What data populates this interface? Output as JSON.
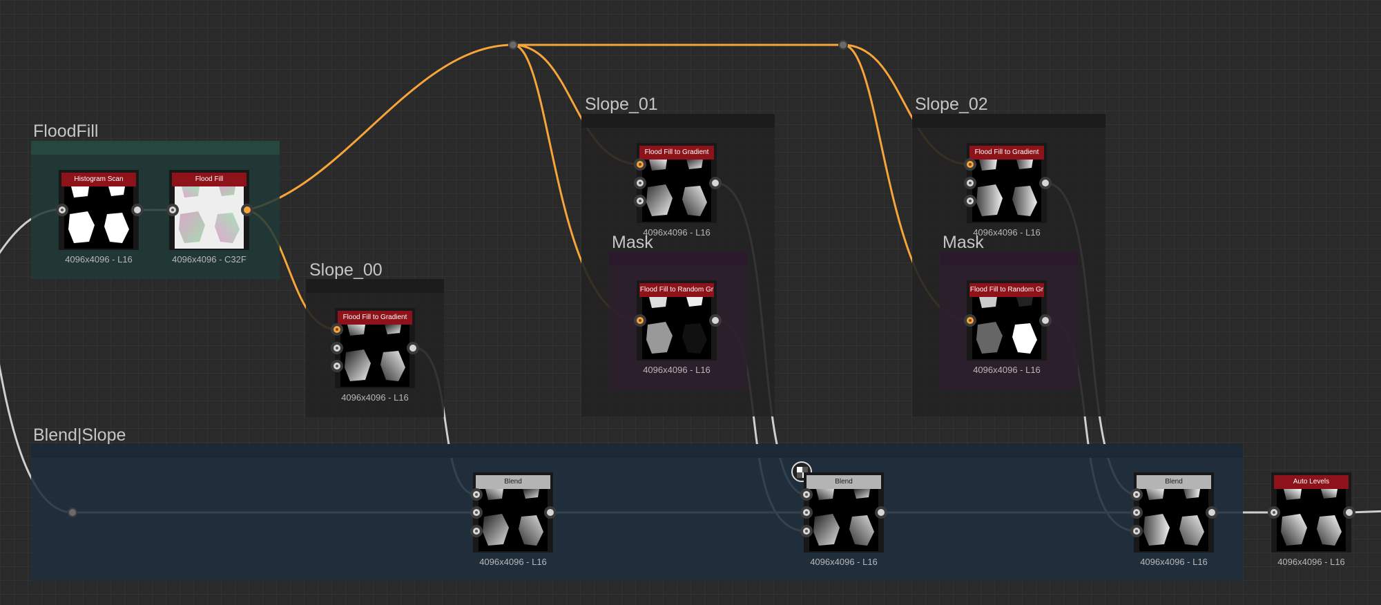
{
  "canvas": {
    "background": "#2a2a2a",
    "wire_orange": "#f7a53a",
    "wire_gray": "#cfcfcf"
  },
  "frames": {
    "floodfill": {
      "title": "FloodFill",
      "color": "#1f3a37"
    },
    "slope_00": {
      "title": "Slope_00",
      "color": "#222222"
    },
    "slope_01": {
      "title": "Slope_01",
      "color": "#222222"
    },
    "slope_02": {
      "title": "Slope_02",
      "color": "#222222"
    },
    "mask_01": {
      "title": "Mask",
      "color": "#2d1f2e"
    },
    "mask_02": {
      "title": "Mask",
      "color": "#2d1f2e"
    },
    "blend_slope": {
      "title": "Blend|Slope",
      "color": "#1f2d3d"
    }
  },
  "nodes": {
    "histogram_scan": {
      "label": "Histogram Scan",
      "info": "4096x4096 - L16"
    },
    "flood_fill": {
      "label": "Flood Fill",
      "info": "4096x4096 - C32F"
    },
    "ff_gradient_00": {
      "label": "Flood Fill to Gradient",
      "info": "4096x4096 - L16"
    },
    "ff_gradient_01": {
      "label": "Flood Fill to Gradient",
      "info": "4096x4096 - L16"
    },
    "ff_random_01": {
      "label": "Flood Fill to Random Gr",
      "info": "4096x4096 - L16"
    },
    "ff_gradient_02": {
      "label": "Flood Fill to Gradient",
      "info": "4096x4096 - L16"
    },
    "ff_random_02": {
      "label": "Flood Fill to Random Gr",
      "info": "4096x4096 - L16"
    },
    "blend_1": {
      "label": "Blend",
      "info": "4096x4096 - L16"
    },
    "blend_2": {
      "label": "Blend",
      "info": "4096x4096 - L16"
    },
    "blend_3": {
      "label": "Blend",
      "info": "4096x4096 - L16"
    },
    "auto_levels": {
      "label": "Auto Levels",
      "info": "4096x4096 - L16"
    }
  }
}
